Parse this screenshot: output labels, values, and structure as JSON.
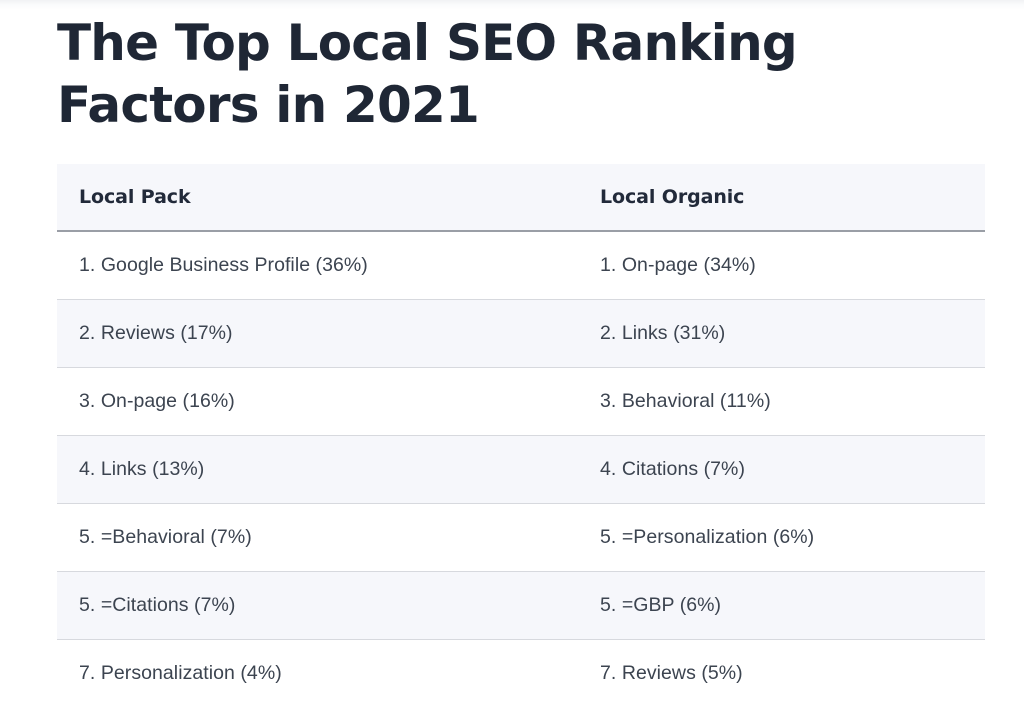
{
  "page": {
    "title": "The Top Local SEO Ranking Factors in 2021",
    "background_color": "#ffffff",
    "title_color": "#1f2735",
    "stripe_color": "#f6f7fb",
    "border_color": "#d7d9de",
    "body_text_color": "#3c4450"
  },
  "table": {
    "columns": [
      {
        "key": "local_pack",
        "label": "Local Pack"
      },
      {
        "key": "local_organic",
        "label": "Local Organic"
      }
    ],
    "rows": [
      {
        "local_pack": "1. Google Business Profile (36%)",
        "local_organic": "1. On-page (34%)"
      },
      {
        "local_pack": "2. Reviews (17%)",
        "local_organic": "2. Links (31%)"
      },
      {
        "local_pack": "3. On-page (16%)",
        "local_organic": "3. Behavioral (11%)"
      },
      {
        "local_pack": "4. Links (13%)",
        "local_organic": "4. Citations (7%)"
      },
      {
        "local_pack": "5. =Behavioral (7%)",
        "local_organic": "5. =Personalization (6%)"
      },
      {
        "local_pack": "5. =Citations (7%)",
        "local_organic": "5. =GBP (6%)"
      },
      {
        "local_pack": "7. Personalization (4%)",
        "local_organic": "7. Reviews (5%)"
      }
    ]
  },
  "chart_data": {
    "type": "table",
    "title": "The Top Local SEO Ranking Factors in 2021",
    "columns": [
      "Local Pack",
      "Local Organic"
    ],
    "series": [
      {
        "name": "Local Pack",
        "categories": [
          "Google Business Profile",
          "Reviews",
          "On-page",
          "Links",
          "Behavioral",
          "Citations",
          "Personalization"
        ],
        "values": [
          36,
          17,
          16,
          13,
          7,
          7,
          4
        ],
        "ranks": [
          1,
          2,
          3,
          4,
          5,
          5,
          7
        ],
        "unit": "%"
      },
      {
        "name": "Local Organic",
        "categories": [
          "On-page",
          "Links",
          "Behavioral",
          "Citations",
          "Personalization",
          "GBP",
          "Reviews"
        ],
        "values": [
          34,
          31,
          11,
          7,
          6,
          6,
          5
        ],
        "ranks": [
          1,
          2,
          3,
          4,
          5,
          5,
          7
        ],
        "unit": "%"
      }
    ]
  }
}
